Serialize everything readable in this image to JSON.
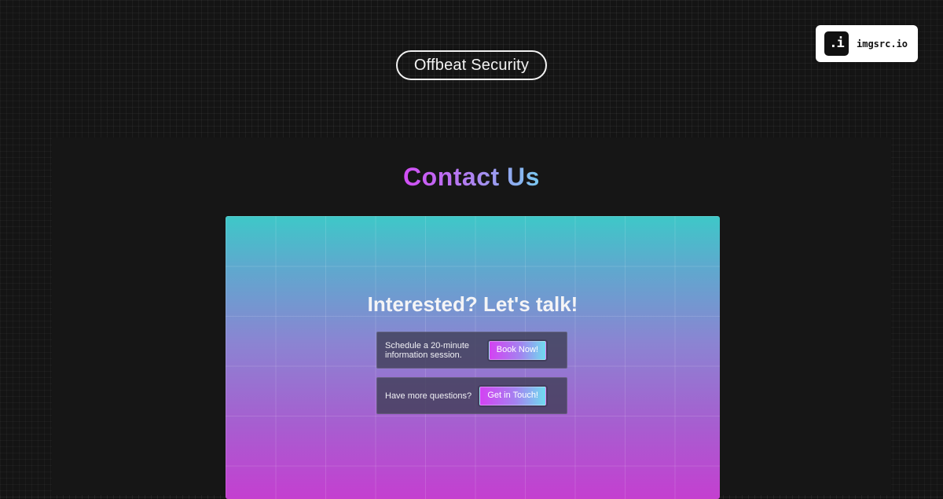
{
  "header": {
    "site_name": "Offbeat Security"
  },
  "brand": {
    "logo_text": ".i",
    "name": "imgsrc.io"
  },
  "main": {
    "heading": "Contact Us",
    "preview": {
      "title": "Interested? Let's talk!",
      "cards": [
        {
          "text_line1": "Schedule a 20-minute",
          "text_line2": "information session.",
          "button_label": "Book Now!"
        },
        {
          "text_line1": "Have more questions?",
          "button_label": "Get in Touch!"
        }
      ]
    }
  },
  "colors": {
    "background": "#141414",
    "panel": "#161616",
    "heading_gradient_start": "#d24df5",
    "heading_gradient_end": "#79c8f0",
    "preview_top": "#3ec8c8",
    "preview_bottom": "#c43fd0"
  },
  "icons": {
    "brand_logo": "imgsrc-logo-icon"
  }
}
